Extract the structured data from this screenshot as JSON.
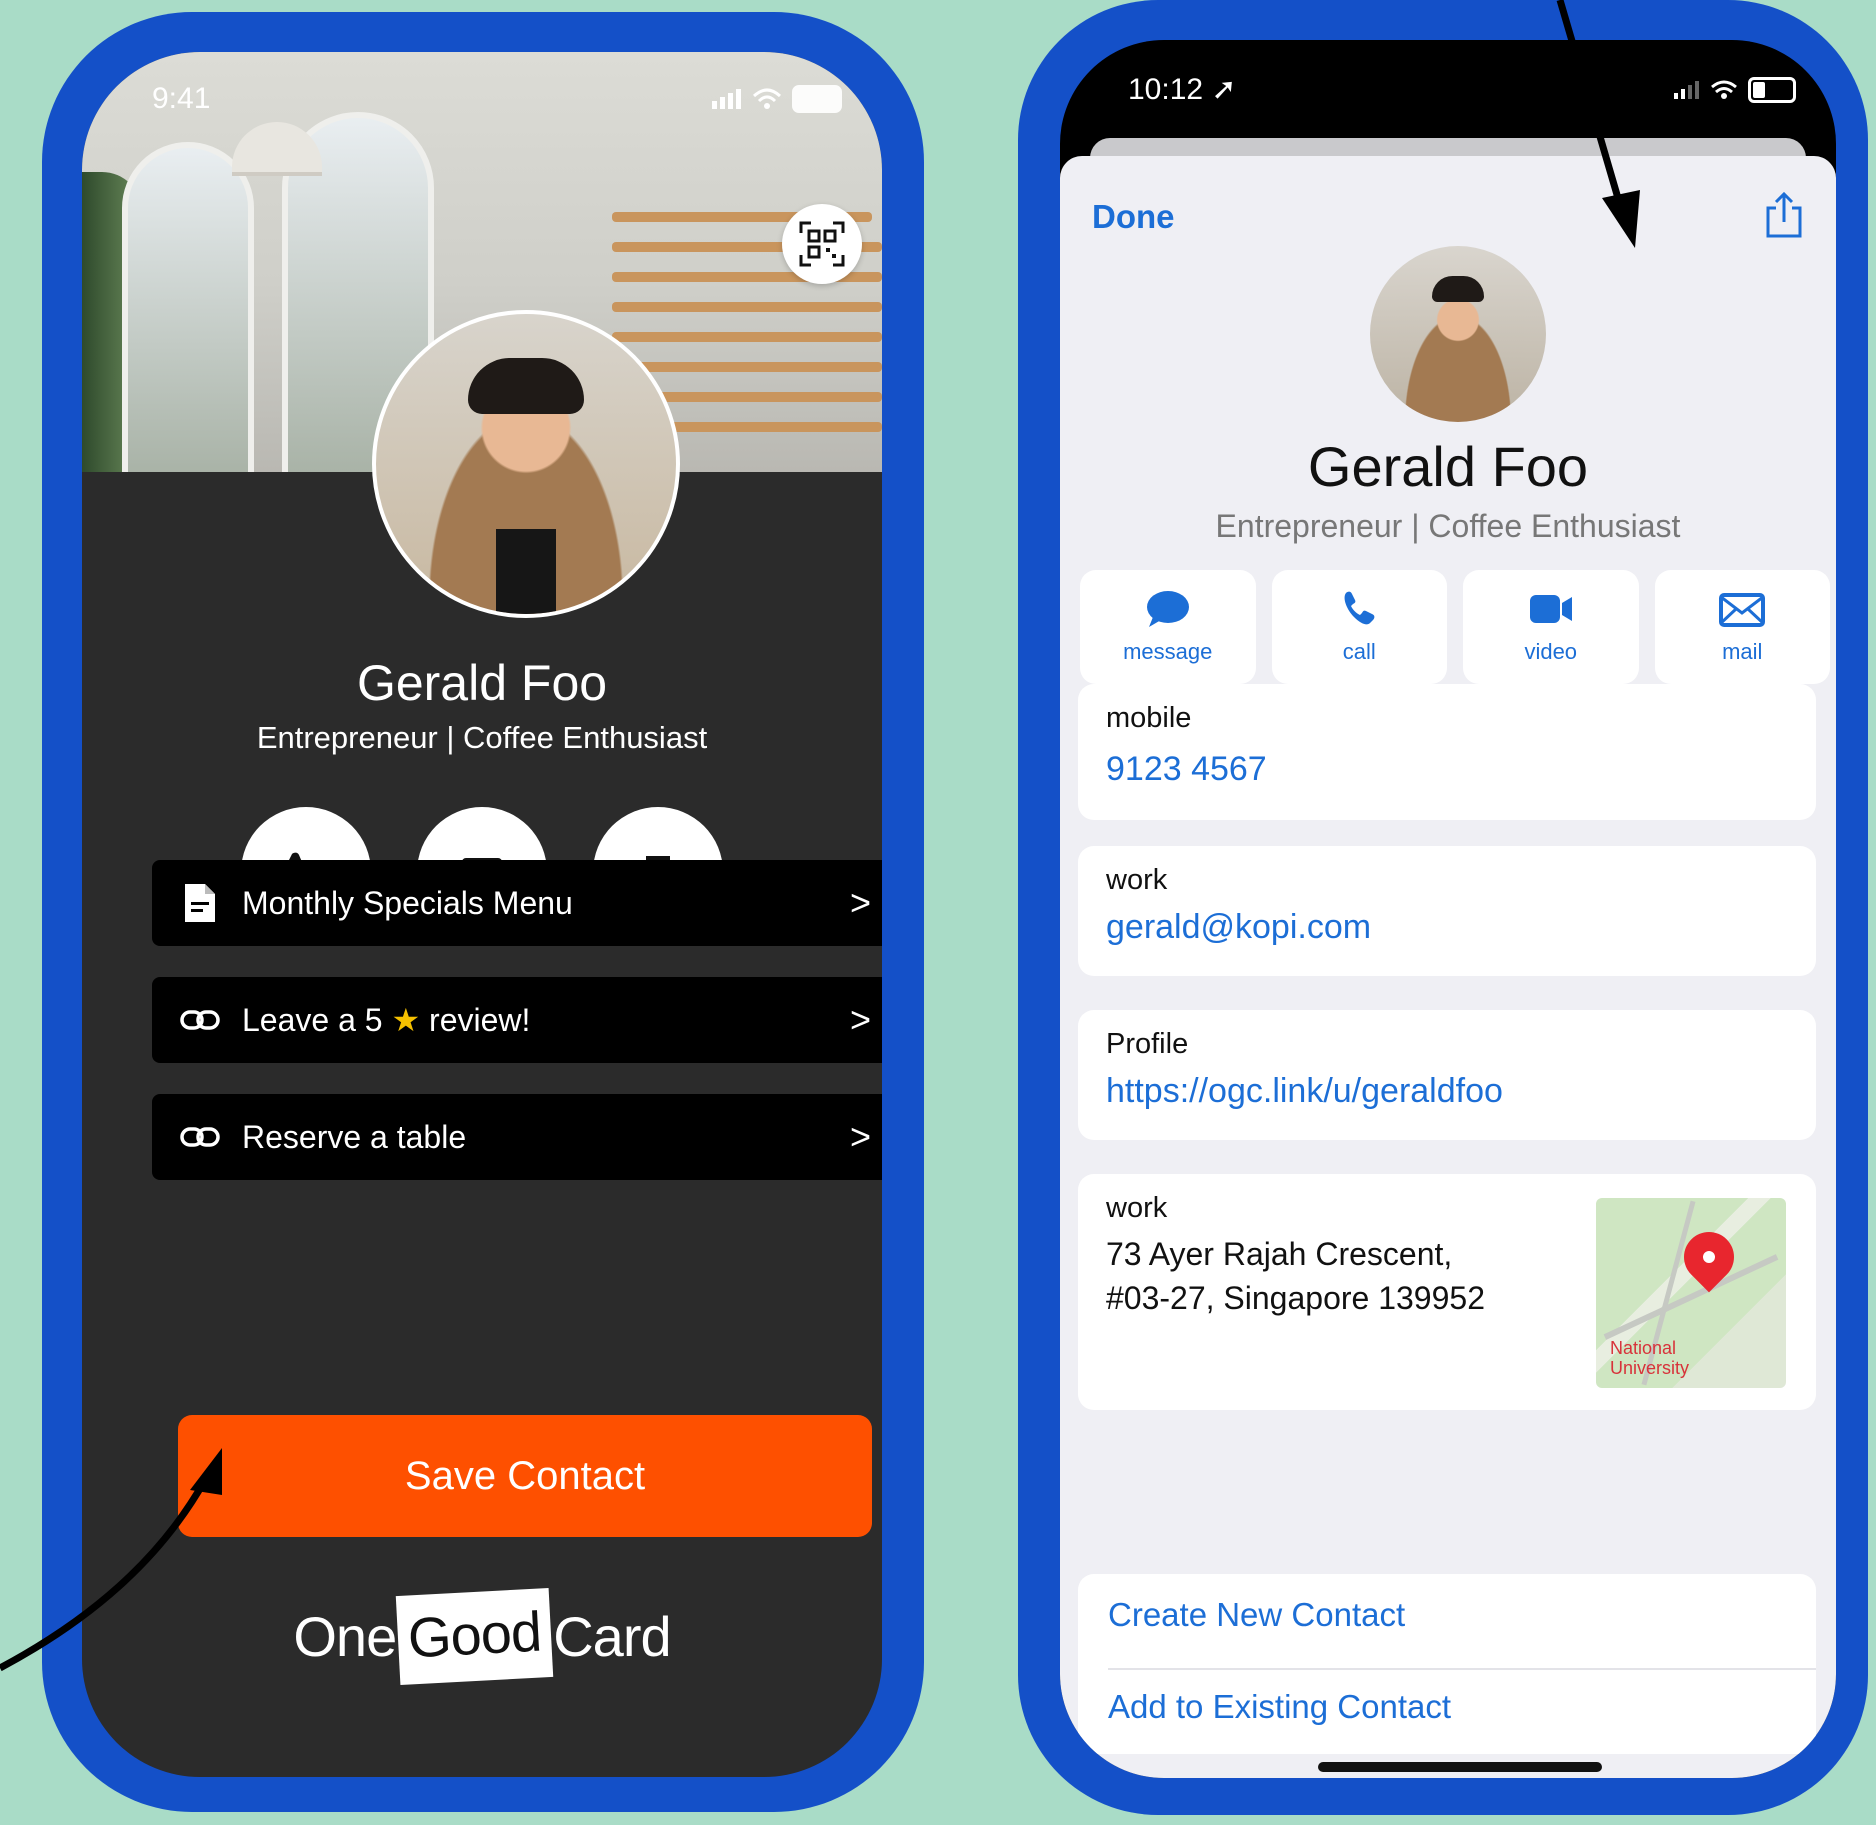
{
  "colors": {
    "background": "#a9dcc7",
    "phone_frame": "#1450c8",
    "save_button": "#fe5000",
    "ios_blue": "#1c6ed6",
    "card_dark": "#2b2b2b"
  },
  "left_phone": {
    "status": {
      "time": "9:41"
    },
    "qr_icon": "qr-code-icon",
    "profile": {
      "name": "Gerald Foo",
      "title": "Entrepreneur | Coffee Enthusiast"
    },
    "quick_actions": [
      {
        "icon": "phone-icon"
      },
      {
        "icon": "mail-icon"
      },
      {
        "icon": "onegoodcard-logo-icon"
      }
    ],
    "links": [
      {
        "icon": "document-icon",
        "label": "Monthly Specials Menu"
      },
      {
        "icon": "link-icon",
        "label_before": "Leave a 5",
        "star": "★",
        "label_after": " review!"
      },
      {
        "icon": "link-icon",
        "label": "Reserve a table"
      }
    ],
    "chevron": ">",
    "save_button": "Save Contact",
    "brand": {
      "part1": "One",
      "part2": "Good",
      "part3": "Card"
    }
  },
  "right_phone": {
    "status": {
      "time": "10:12"
    },
    "nav": {
      "done": "Done"
    },
    "contact": {
      "name": "Gerald Foo",
      "title": "Entrepreneur | Coffee Enthusiast"
    },
    "actions": [
      {
        "icon": "message-icon",
        "label": "message"
      },
      {
        "icon": "phone-icon",
        "label": "call"
      },
      {
        "icon": "video-icon",
        "label": "video"
      },
      {
        "icon": "mail-icon",
        "label": "mail"
      }
    ],
    "fields": {
      "mobile": {
        "label": "mobile",
        "value": "9123 4567"
      },
      "email": {
        "label": "work",
        "value": "gerald@kopi.com"
      },
      "profile": {
        "label": "Profile",
        "value": "https://ogc.link/u/geraldfoo"
      },
      "address": {
        "label": "work",
        "line1": "73 Ayer Rajah Crescent,",
        "line2": "#03-27, Singapore 139952",
        "map_label_1": "National",
        "map_label_2": "University"
      }
    },
    "bottom_actions": {
      "create": "Create New Contact",
      "add_existing": "Add to Existing Contact"
    }
  }
}
